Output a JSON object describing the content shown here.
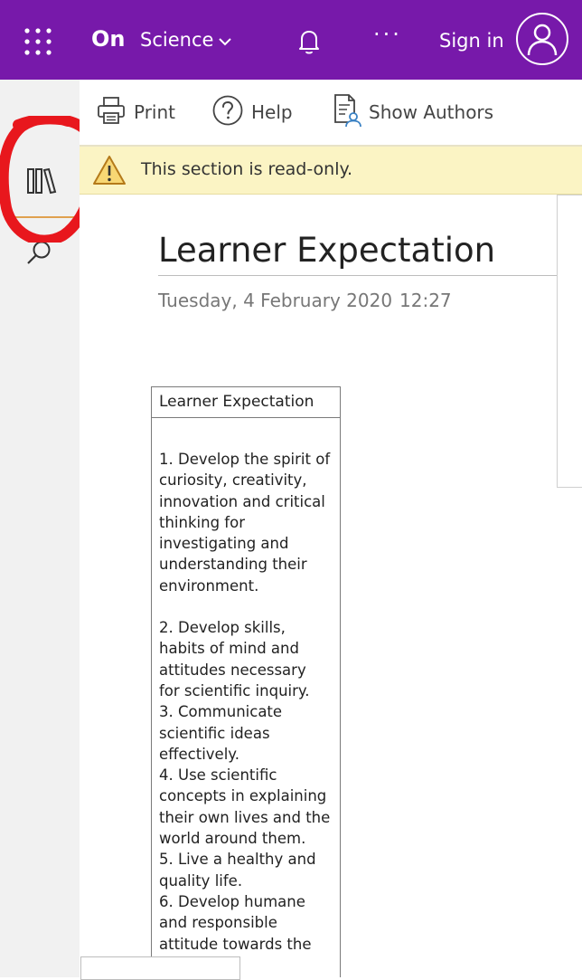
{
  "header": {
    "app_logo": "On",
    "notebook_name": "Science",
    "more_label": "···",
    "signin_label": "Sign in",
    "icons": [
      "app-launcher-icon",
      "chevron-down-icon",
      "bell-icon",
      "more-icon",
      "person-icon"
    ],
    "brand_color": "#7719aa"
  },
  "toolbar": {
    "print_label": "Print",
    "help_label": "Help",
    "show_authors_label": "Show Authors"
  },
  "sidebar": {
    "items": [
      {
        "name": "notebooks",
        "icon": "notebooks-icon"
      },
      {
        "name": "search",
        "icon": "search-icon"
      }
    ]
  },
  "infobar": {
    "message": "This section is read-only.",
    "icon": "warning-icon"
  },
  "page": {
    "title": "Learner Expectation",
    "date": "Tuesday, 4 February 2020",
    "time": "12:27",
    "table": {
      "header": "Learner Expectation",
      "items": [
        [
          "1. Develop the spirit of",
          "curiosity, creativity,",
          "innovation and critical",
          "thinking for",
          "investigating and",
          "understanding their",
          "environment."
        ],
        [
          "2. Develop skills,",
          "habits of mind and",
          "attitudes necessary",
          "for scientific inquiry."
        ],
        [
          "3. Communicate",
          "scientific ideas",
          "effectively."
        ],
        [
          "4. Use scientific",
          "concepts in explaining",
          "their own lives and the",
          "world around them."
        ],
        [
          "5. Live a healthy and",
          "quality life."
        ],
        [
          "6. Develop humane",
          "and responsible",
          "attitude towards the"
        ]
      ]
    }
  },
  "annotation": {
    "color": "#e8171d"
  }
}
